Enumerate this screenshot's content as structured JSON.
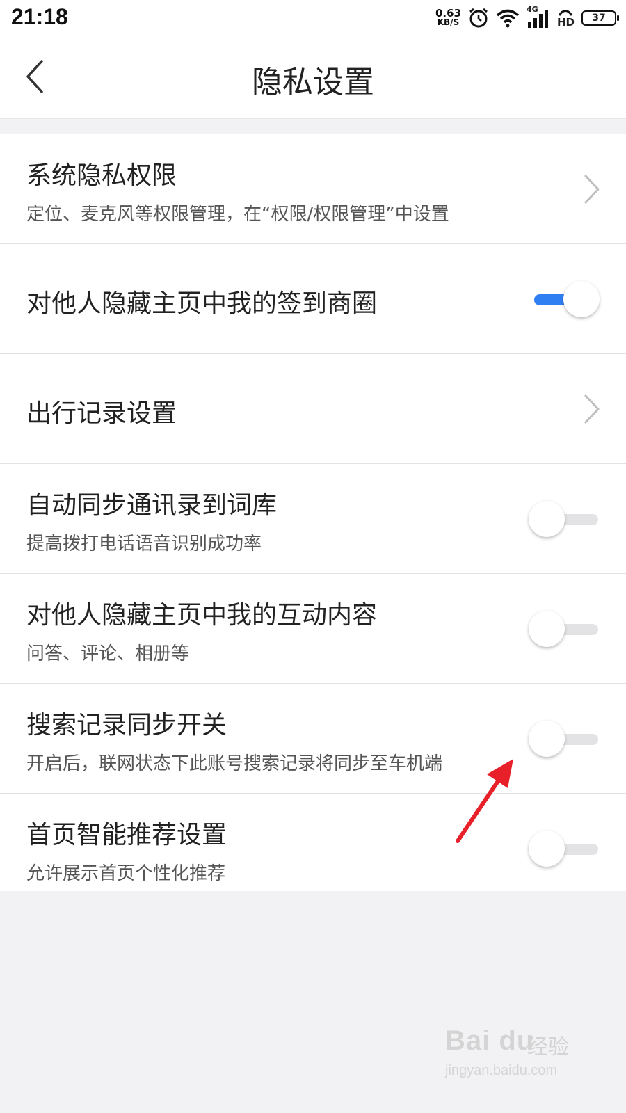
{
  "status_bar": {
    "time": "21:18",
    "net_speed_value": "0.63",
    "net_speed_unit": "KB/S",
    "network_label": "4G",
    "hd_label": "HD",
    "battery": "37",
    "icons": [
      "alarm-icon",
      "wifi-icon",
      "signal-icon",
      "hd-voice-icon",
      "battery-icon"
    ]
  },
  "header": {
    "title": "隐私设置",
    "back_icon": "back-chevron-icon"
  },
  "settings": [
    {
      "title": "系统隐私权限",
      "subtitle": "定位、麦克风等权限管理，在“权限/权限管理”中设置",
      "control": "chevron"
    },
    {
      "title": "对他人隐藏主页中我的签到商圈",
      "subtitle": "",
      "control": "toggle",
      "on": true
    },
    {
      "title": "出行记录设置",
      "subtitle": "",
      "control": "chevron"
    },
    {
      "title": "自动同步通讯录到词库",
      "subtitle": "提高拨打电话语音识别成功率",
      "control": "toggle",
      "on": false
    },
    {
      "title": "对他人隐藏主页中我的互动内容",
      "subtitle": "问答、评论、相册等",
      "control": "toggle",
      "on": false
    },
    {
      "title": "搜索记录同步开关",
      "subtitle": "开启后，联网状态下此账号搜索记录将同步至车机端",
      "control": "toggle",
      "on": false
    },
    {
      "title": "首页智能推荐设置",
      "subtitle": "允许展示首页个性化推荐",
      "control": "toggle",
      "on": false
    }
  ],
  "colors": {
    "toggle_on": "#2f7ef2",
    "annotation_arrow": "#e8202a",
    "background": "#f2f2f4"
  },
  "watermark": {
    "brand": "Bai du",
    "cn": "经验",
    "url": "jingyan.baidu.com"
  }
}
